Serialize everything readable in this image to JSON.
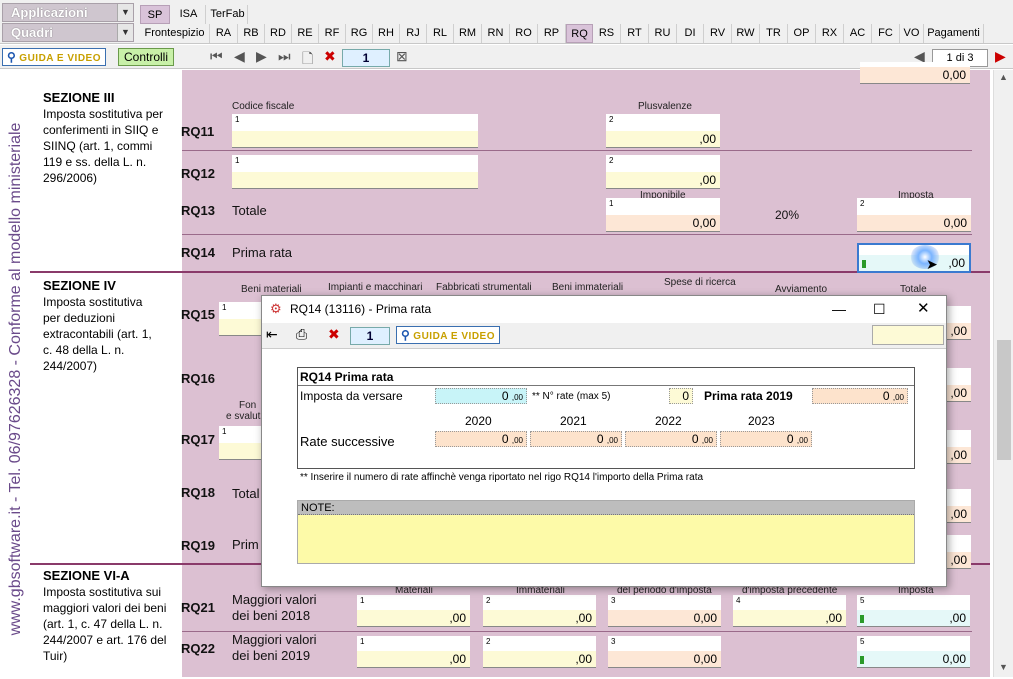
{
  "top": {
    "select1": "Applicazioni",
    "select2": "Quadri",
    "tabs_row1": [
      "SP",
      "ISA",
      "TerFab"
    ],
    "tabs_row2": [
      "Frontespizio",
      "RA",
      "RB",
      "RD",
      "RE",
      "RF",
      "RG",
      "RH",
      "RJ",
      "RL",
      "RM",
      "RN",
      "RO",
      "RP",
      "RQ",
      "RS",
      "RT",
      "RU",
      "DI",
      "RV",
      "RW",
      "TR",
      "OP",
      "RX",
      "AC",
      "FC",
      "VO",
      "Pagamenti"
    ]
  },
  "toolbar": {
    "guida_label": "GUIDA E VIDEO",
    "controlli_label": "Controlli",
    "page_value": "1",
    "page_of": "1 di 3"
  },
  "side_text": "www.gbsoftware.it - Tel. 06/97626328 - Conforme al modello ministeriale",
  "form": {
    "top_value": "0,00",
    "sez3_title": "SEZIONE III",
    "sez3_desc": "Imposta sostitutiva per conferimenti in SIIQ e SIINQ (art. 1, commi 119 e ss. della L. n. 296/2006)",
    "hdr_codice": "Codice fiscale",
    "hdr_plus": "Plusvalenze",
    "hdr_imponibile": "Imponibile",
    "hdr_imposta": "Imposta",
    "rq11": "RQ11",
    "rq12": "RQ12",
    "rq13": "RQ13",
    "rq14": "RQ14",
    "rq13_txt": "Totale",
    "rq14_txt": "Prima rata",
    "pct": "20%",
    "v00": ",00",
    "v000": "0,00",
    "sez4_title": "SEZIONE IV",
    "sez4_desc": "Imposta sostitutiva per deduzioni extracontabili (art. 1, c. 48 della L. n. 244/2007)",
    "hdr_beni_mat": "Beni materiali",
    "hdr_impianti": "Impianti e macchinari",
    "hdr_fabbricati": "Fabbricati strumentali",
    "hdr_beni_imm": "Beni immateriali",
    "hdr_spese": "Spese di ricerca",
    "hdr_avv": "Avviamento",
    "hdr_totale": "Totale",
    "hdr_fon": "Fon",
    "hdr_svalut": "e svaluta",
    "rq15": "RQ15",
    "rq16": "RQ16",
    "rq17": "RQ17",
    "rq18": "RQ18",
    "rq19": "RQ19",
    "rq18_txt": "Total",
    "rq19_txt": "Prim",
    "sez6_title": "SEZIONE VI-A",
    "sez6_desc": "Imposta sostitutiva sui maggiori valori dei beni (art. 1, c. 47 della L. n. 244/2007 e art. 176 del Tuir)",
    "hdr_materiali": "Materiali",
    "hdr_immateriali": "Immateriali",
    "hdr_periodo": "del periodo d'imposta",
    "hdr_precedente": "d'imposta precedente",
    "hdr_imposta2": "Imposta",
    "rq21": "RQ21",
    "rq22": "RQ22",
    "rq21_txt1": "Maggiori valori",
    "rq21_txt2": "dei beni 2018",
    "rq22_txt1": "Maggiori valori",
    "rq22_txt2": "dei beni 2019"
  },
  "dialog": {
    "title": "RQ14 (13116) - Prima rata",
    "page_value": "1",
    "guida_label": "GUIDA E VIDEO",
    "box_title": "RQ14 Prima rata",
    "imposta_label": "Imposta da versare",
    "imposta_value": "0",
    "nrate_label": "** N° rate (max 5)",
    "nrate_value": "0",
    "prima_label": "Prima rata 2019",
    "prima_value": "0",
    "rate_label": "Rate successive",
    "years": [
      "2020",
      "2021",
      "2022",
      "2023"
    ],
    "rate_values": [
      "0",
      "0",
      "0",
      "0"
    ],
    "dec": ",00",
    "note_text": "** Inserire il numero di rate affinchè venga riportato nel rigo RQ14  l'importo della Prima rata",
    "note_label": "NOTE:"
  }
}
